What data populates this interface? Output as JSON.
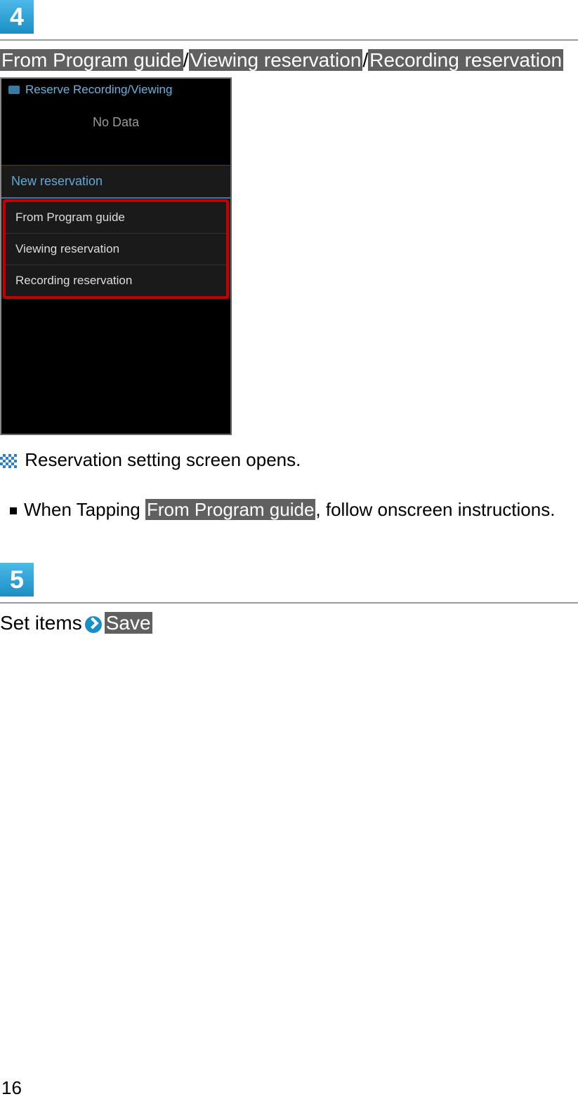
{
  "step4": {
    "number": "4",
    "breadcrumb": {
      "option1": "From Program guide",
      "sep1": "/",
      "option2": "Viewing reservation",
      "sep2": "/",
      "option3": "Recording reservation"
    },
    "mock": {
      "header": "Reserve Recording/Viewing",
      "nodata": "No Data",
      "overlay_title": "New reservation",
      "item1": "From Program guide",
      "item2": "Viewing reservation",
      "item3": "Recording reservation"
    },
    "result_text": " Reservation setting screen opens.",
    "bullet_prefix": "When Tapping ",
    "bullet_label": "From Program guide",
    "bullet_suffix": ", follow onscreen instructions."
  },
  "step5": {
    "number": "5",
    "prefix": "Set items",
    "save_label": "Save"
  },
  "page_number": "16"
}
